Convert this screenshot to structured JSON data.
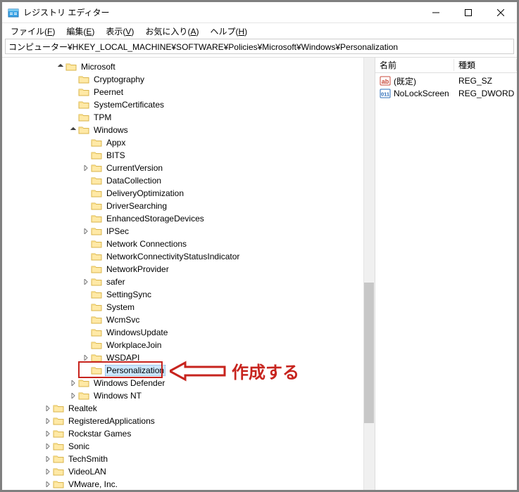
{
  "window": {
    "title": "レジストリ エディター"
  },
  "menu": {
    "file": "ファイル",
    "file_u": "F",
    "edit": "編集",
    "edit_u": "E",
    "view": "表示",
    "view_u": "V",
    "fav": "お気に入り",
    "fav_u": "A",
    "help": "ヘルプ",
    "help_u": "H"
  },
  "address": "コンピューター¥HKEY_LOCAL_MACHINE¥SOFTWARE¥Policies¥Microsoft¥Windows¥Personalization",
  "tree": [
    {
      "indent": 4,
      "arrow": "down",
      "label": "Microsoft"
    },
    {
      "indent": 5,
      "arrow": "none",
      "label": "Cryptography"
    },
    {
      "indent": 5,
      "arrow": "none",
      "label": "Peernet"
    },
    {
      "indent": 5,
      "arrow": "none",
      "label": "SystemCertificates"
    },
    {
      "indent": 5,
      "arrow": "none",
      "label": "TPM"
    },
    {
      "indent": 5,
      "arrow": "down",
      "label": "Windows"
    },
    {
      "indent": 6,
      "arrow": "none",
      "label": "Appx"
    },
    {
      "indent": 6,
      "arrow": "none",
      "label": "BITS"
    },
    {
      "indent": 6,
      "arrow": "right",
      "label": "CurrentVersion"
    },
    {
      "indent": 6,
      "arrow": "none",
      "label": "DataCollection"
    },
    {
      "indent": 6,
      "arrow": "none",
      "label": "DeliveryOptimization"
    },
    {
      "indent": 6,
      "arrow": "none",
      "label": "DriverSearching"
    },
    {
      "indent": 6,
      "arrow": "none",
      "label": "EnhancedStorageDevices"
    },
    {
      "indent": 6,
      "arrow": "right",
      "label": "IPSec"
    },
    {
      "indent": 6,
      "arrow": "none",
      "label": "Network Connections"
    },
    {
      "indent": 6,
      "arrow": "none",
      "label": "NetworkConnectivityStatusIndicator"
    },
    {
      "indent": 6,
      "arrow": "none",
      "label": "NetworkProvider"
    },
    {
      "indent": 6,
      "arrow": "right",
      "label": "safer"
    },
    {
      "indent": 6,
      "arrow": "none",
      "label": "SettingSync"
    },
    {
      "indent": 6,
      "arrow": "none",
      "label": "System"
    },
    {
      "indent": 6,
      "arrow": "none",
      "label": "WcmSvc"
    },
    {
      "indent": 6,
      "arrow": "none",
      "label": "WindowsUpdate"
    },
    {
      "indent": 6,
      "arrow": "none",
      "label": "WorkplaceJoin"
    },
    {
      "indent": 6,
      "arrow": "right",
      "label": "WSDAPI"
    },
    {
      "indent": 6,
      "arrow": "none",
      "label": "Personalization",
      "selected": true,
      "highlight": true
    },
    {
      "indent": 5,
      "arrow": "right",
      "label": "Windows Defender"
    },
    {
      "indent": 5,
      "arrow": "right",
      "label": "Windows NT"
    },
    {
      "indent": 3,
      "arrow": "right",
      "label": "Realtek"
    },
    {
      "indent": 3,
      "arrow": "right",
      "label": "RegisteredApplications"
    },
    {
      "indent": 3,
      "arrow": "right",
      "label": "Rockstar Games"
    },
    {
      "indent": 3,
      "arrow": "right",
      "label": "Sonic"
    },
    {
      "indent": 3,
      "arrow": "right",
      "label": "TechSmith"
    },
    {
      "indent": 3,
      "arrow": "right",
      "label": "VideoLAN"
    },
    {
      "indent": 3,
      "arrow": "right",
      "label": "VMware, Inc."
    }
  ],
  "annotation": {
    "text": "作成する"
  },
  "list": {
    "columns": {
      "name": "名前",
      "type": "種類"
    },
    "rows": [
      {
        "icon": "ab",
        "name": "(既定)",
        "type": "REG_SZ"
      },
      {
        "icon": "011",
        "name": "NoLockScreen",
        "type": "REG_DWORD"
      }
    ]
  }
}
